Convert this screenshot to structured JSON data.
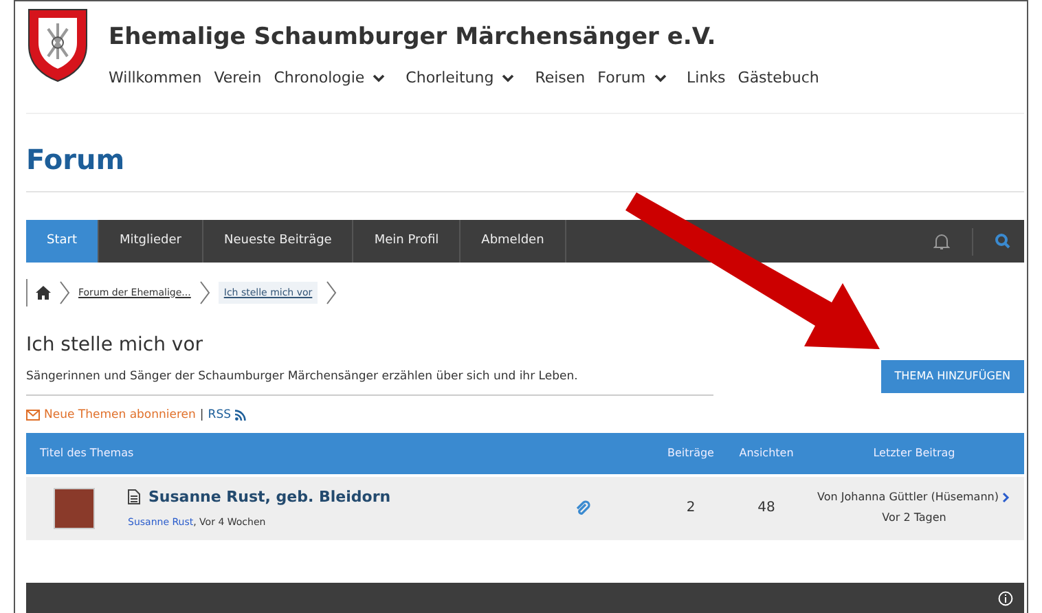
{
  "header": {
    "site_title": "Ehemalige Schaumburger Märchensänger e.V.",
    "menu": [
      {
        "label": "Willkommen",
        "dropdown": false
      },
      {
        "label": "Verein",
        "dropdown": false
      },
      {
        "label": "Chronologie",
        "dropdown": true
      },
      {
        "label": "Chorleitung",
        "dropdown": true
      },
      {
        "label": "Reisen",
        "dropdown": false
      },
      {
        "label": "Forum",
        "dropdown": true
      },
      {
        "label": "Links",
        "dropdown": false
      },
      {
        "label": "Gästebuch",
        "dropdown": false
      }
    ]
  },
  "page_title": "Forum",
  "forum_nav": {
    "tabs": [
      {
        "label": "Start",
        "selected": true
      },
      {
        "label": "Mitglieder",
        "selected": false
      },
      {
        "label": "Neueste Beiträge",
        "selected": false
      },
      {
        "label": "Mein Profil",
        "selected": false
      },
      {
        "label": "Abmelden",
        "selected": false
      }
    ]
  },
  "breadcrumb": [
    {
      "label": "Forum der Ehemalige...",
      "selected": false
    },
    {
      "label": "Ich stelle mich vor",
      "selected": true
    }
  ],
  "category": {
    "title": "Ich stelle mich vor",
    "description": "Sängerinnen und Sänger der Schaumburger Märchensänger erzählen über sich und ihr Leben.",
    "button": "THEMA HINZUFÜGEN",
    "subscribe": "Neue Themen abonnieren",
    "separator": "|",
    "rss": "RSS"
  },
  "table": {
    "columns": [
      "Titel des Themas",
      "Beiträge",
      "Ansichten",
      "Letzter Beitrag"
    ],
    "rows": [
      {
        "title": "Susanne Rust, geb. Bleidorn",
        "author": "Susanne Rust",
        "age": ", Vor 4 Wochen",
        "attachment": true,
        "posts": "2",
        "views": "48",
        "last_by": "Von Johanna Güttler (Hüsemann)",
        "last_time": "Vor 2 Tagen"
      }
    ]
  }
}
